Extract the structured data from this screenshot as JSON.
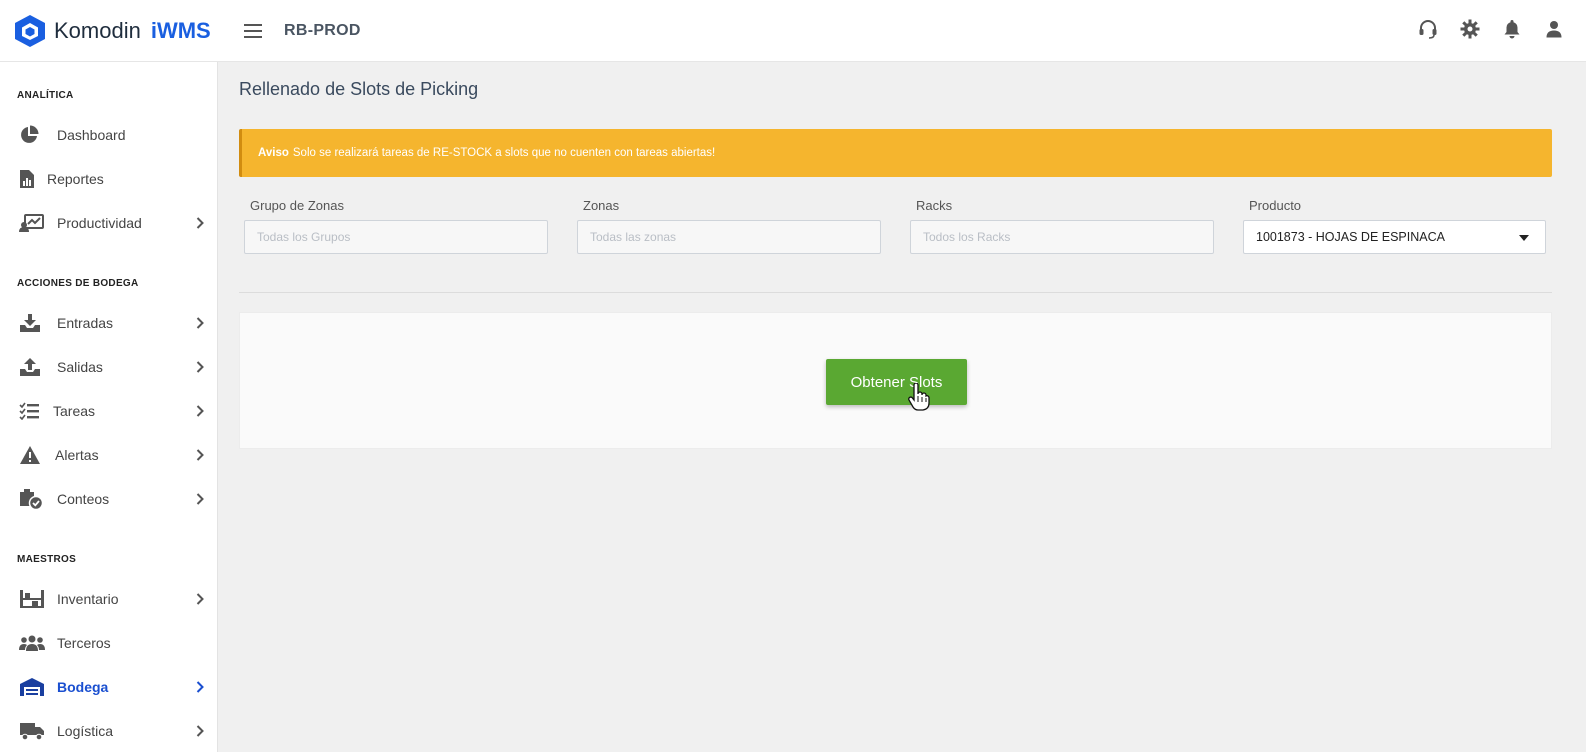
{
  "brand": {
    "name": "Komodin",
    "suffix": "iWMS",
    "color": "#1a5fe0"
  },
  "header": {
    "environment": "RB-PROD",
    "icons": [
      "headset-icon",
      "gear-icon",
      "bell-icon",
      "user-icon"
    ]
  },
  "sidebar": {
    "sections": [
      {
        "title": "ANALÍTICA",
        "items": [
          {
            "label": "Dashboard",
            "icon": "pie-chart-icon",
            "has_children": false
          },
          {
            "label": "Reportes",
            "icon": "report-icon",
            "has_children": false
          },
          {
            "label": "Productividad",
            "icon": "productivity-icon",
            "has_children": true
          }
        ]
      },
      {
        "title": "ACCIONES DE BODEGA",
        "items": [
          {
            "label": "Entradas",
            "icon": "inbox-in-icon",
            "has_children": true
          },
          {
            "label": "Salidas",
            "icon": "inbox-out-icon",
            "has_children": true
          },
          {
            "label": "Tareas",
            "icon": "task-list-icon",
            "has_children": true
          },
          {
            "label": "Alertas",
            "icon": "warning-icon",
            "has_children": true
          },
          {
            "label": "Conteos",
            "icon": "count-check-icon",
            "has_children": true
          }
        ]
      },
      {
        "title": "MAESTROS",
        "items": [
          {
            "label": "Inventario",
            "icon": "warehouse-shelf-icon",
            "has_children": true
          },
          {
            "label": "Terceros",
            "icon": "users-icon",
            "has_children": false
          },
          {
            "label": "Bodega",
            "icon": "warehouse-icon",
            "has_children": true,
            "active": true
          },
          {
            "label": "Logística",
            "icon": "truck-icon",
            "has_children": true
          }
        ]
      }
    ]
  },
  "main": {
    "title": "Rellenado de Slots de Picking",
    "alert": {
      "label": "Aviso",
      "text": "Solo se realizará tareas de RE-STOCK a slots que no cuenten con tareas abiertas!",
      "color": "#f5b52e"
    },
    "filters": [
      {
        "label": "Grupo de Zonas",
        "placeholder": "Todas los Grupos"
      },
      {
        "label": "Zonas",
        "placeholder": "Todas las zonas"
      },
      {
        "label": "Racks",
        "placeholder": "Todos los Racks"
      }
    ],
    "product": {
      "label": "Producto",
      "selected": "1001873 - HOJAS DE ESPINACA"
    },
    "action_button": {
      "label": "Obtener Slots",
      "color": "#5aa832"
    }
  }
}
